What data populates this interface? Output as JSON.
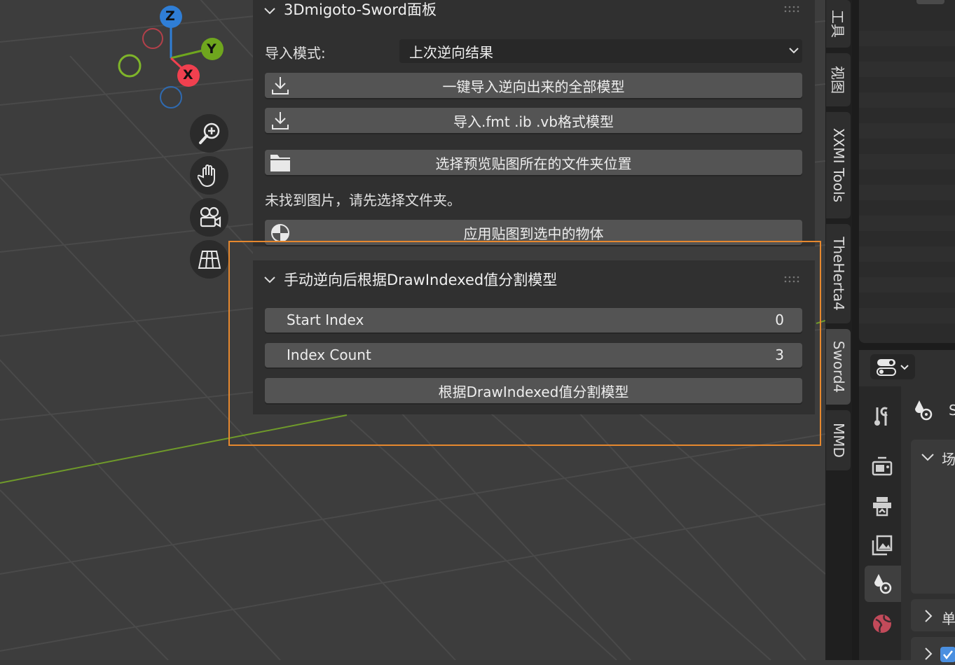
{
  "gizmo": {
    "axis_z": "Z",
    "axis_y": "Y",
    "axis_x": "X",
    "colors": {
      "x": "#f0404f",
      "y": "#6fa61e",
      "z": "#2f7ed6"
    }
  },
  "nav_icons": [
    "zoom-icon",
    "hand-pan-icon",
    "camera-view-icon",
    "grid-perspective-icon"
  ],
  "panel_main": {
    "title": "3Dmigoto-Sword面板",
    "import_mode_label": "导入模式:",
    "import_mode_value": "上次逆向结果",
    "btn_import_all": "一键导入逆向出来的全部模型",
    "btn_import_fmt": "导入.fmt .ib .vb格式模型",
    "btn_select_folder": "选择预览贴图所在的文件夹位置",
    "no_image_text": "未找到图片，请先选择文件夹。",
    "btn_apply_texture": "应用贴图到选中的物体"
  },
  "panel_split": {
    "title": "手动逆向后根据DrawIndexed值分割模型",
    "start_index_label": "Start Index",
    "start_index_value": "0",
    "index_count_label": "Index Count",
    "index_count_value": "3",
    "btn_split": "根据DrawIndexed值分割模型"
  },
  "sidebar_tabs": [
    "工具",
    "视图",
    "XXMI Tools",
    "TheHerta4",
    "Sword4",
    "MMD"
  ],
  "active_tab": "Sword4",
  "properties": {
    "section_scene": "场",
    "section_units": "单",
    "header_partial": "S"
  },
  "accent": "#e6882e"
}
